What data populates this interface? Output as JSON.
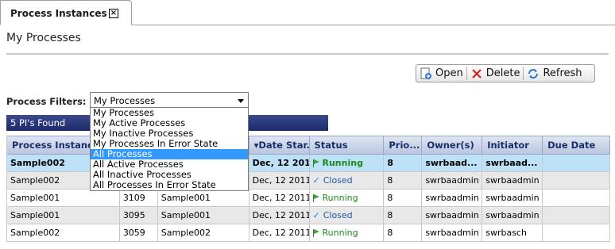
{
  "tab": {
    "label": "Process Instances",
    "close_glyph": "×"
  },
  "page": {
    "title": "My Processes"
  },
  "toolbar": {
    "open_label": "Open",
    "delete_label": "Delete",
    "refresh_label": "Refresh"
  },
  "filter": {
    "label": "Process Filters:",
    "selected": "My Processes",
    "options": [
      "My Processes",
      "My Active Processes",
      "My Inactive Processes",
      "My Processes In Error State",
      "All Processes",
      "All Active Processes",
      "All Inactive Processes",
      "All Processes In Error State"
    ],
    "highlighted_index": 4
  },
  "count_text": "5 PI's Found",
  "grid": {
    "columns": [
      "Process Instance",
      "",
      "",
      "Date Star...",
      "Status",
      "Prio...",
      "Owner(s)",
      "Initiator",
      "Due Date"
    ],
    "rows": [
      {
        "name": "Sample002",
        "id": "",
        "template": "",
        "date": "Dec, 12 2011",
        "status": "Running",
        "priority": "8",
        "owner": "swrbaad...",
        "initiator": "swrbaad...",
        "due": ""
      },
      {
        "name": "Sample002",
        "id": "",
        "template": "",
        "date": "Dec, 12 2011",
        "status": "Closed",
        "priority": "8",
        "owner": "swrbaadmin",
        "initiator": "swrbaadmin",
        "due": ""
      },
      {
        "name": "Sample001",
        "id": "3109",
        "template": "Sample001",
        "date": "Dec, 12 2011",
        "status": "Running",
        "priority": "8",
        "owner": "swrbaadmin",
        "initiator": "swrbaadmin",
        "due": ""
      },
      {
        "name": "Sample001",
        "id": "3095",
        "template": "Sample001",
        "date": "Dec, 12 2011",
        "status": "Closed",
        "priority": "8",
        "owner": "swrbaadmin",
        "initiator": "swrbaadmin",
        "due": ""
      },
      {
        "name": "Sample002",
        "id": "3059",
        "template": "Sample002",
        "date": "Dec, 12 2011",
        "status": "Running",
        "priority": "8",
        "owner": "swrbaadmin",
        "initiator": "swrbasch",
        "due": ""
      }
    ]
  },
  "colors": {
    "header_bar": "#1d2a6b",
    "selected_row": "#bde1f7",
    "running": "#1a8a1a",
    "closed": "#1a5aa8"
  }
}
